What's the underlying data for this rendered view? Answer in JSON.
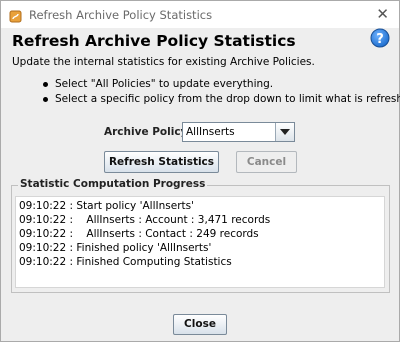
{
  "window": {
    "title": "Refresh Archive Policy Statistics"
  },
  "header": {
    "heading": "Refresh Archive Policy Statistics",
    "description": "Update the internal statistics for existing Archive Policies."
  },
  "instructions": [
    "Select \"All Policies\" to update everything.",
    "Select a specific policy from the drop down to limit what is refreshed."
  ],
  "policy": {
    "label": "Archive Policy:",
    "selected": "AllInserts"
  },
  "buttons": {
    "refresh": "Refresh Statistics",
    "cancel": "Cancel",
    "close": "Close"
  },
  "progress": {
    "title": "Statistic Computation Progress",
    "lines": [
      "09:10:22 : Start policy 'AllInserts'",
      "09:10:22 :    AllInserts : Account : 3,471 records",
      "09:10:22 :    AllInserts : Contact : 249 records",
      "09:10:22 : Finished policy 'AllInserts'",
      "09:10:22 : Finished Computing Statistics"
    ]
  },
  "icons": {
    "app": "java-app-icon",
    "help": "help-icon",
    "close": "close-icon",
    "dropdown": "chevron-down-icon"
  },
  "colors": {
    "help_blue": "#1f6fcf",
    "dialog_bg": "#eeeeee"
  }
}
